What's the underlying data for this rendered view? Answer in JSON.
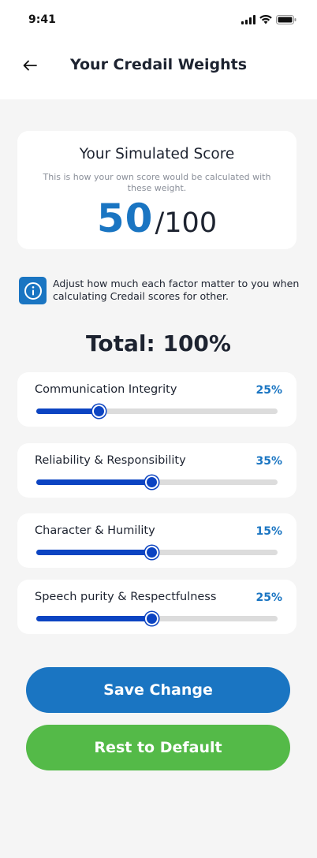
{
  "status_bar": {
    "time": "9:41"
  },
  "header": {
    "title": "Your Credail Weights"
  },
  "score_card": {
    "title": "Your Simulated Score",
    "subtitle": "This is how your own score would be calculated with these weight.",
    "score": "50",
    "out_of": "/100"
  },
  "info": {
    "icon": "info-icon",
    "text": "Adjust how much each factor matter to you when calculating Credail scores for other."
  },
  "total": "Total: 100%",
  "factors": [
    {
      "label": "Communication Integrity",
      "percent_label": "25%",
      "slider_fraction": 0.26
    },
    {
      "label": "Reliability & Responsibility",
      "percent_label": "35%",
      "slider_fraction": 0.48
    },
    {
      "label": "Character & Humility",
      "percent_label": "15%",
      "slider_fraction": 0.48
    },
    {
      "label": "Speech purity & Respectfulness",
      "percent_label": "25%",
      "slider_fraction": 0.48
    }
  ],
  "buttons": {
    "save": "Save Change",
    "reset": "Rest to Default"
  },
  "colors": {
    "primary": "#1a75c2",
    "slider": "#0c44c2",
    "success": "#54ba48",
    "background": "#f5f5f5"
  }
}
